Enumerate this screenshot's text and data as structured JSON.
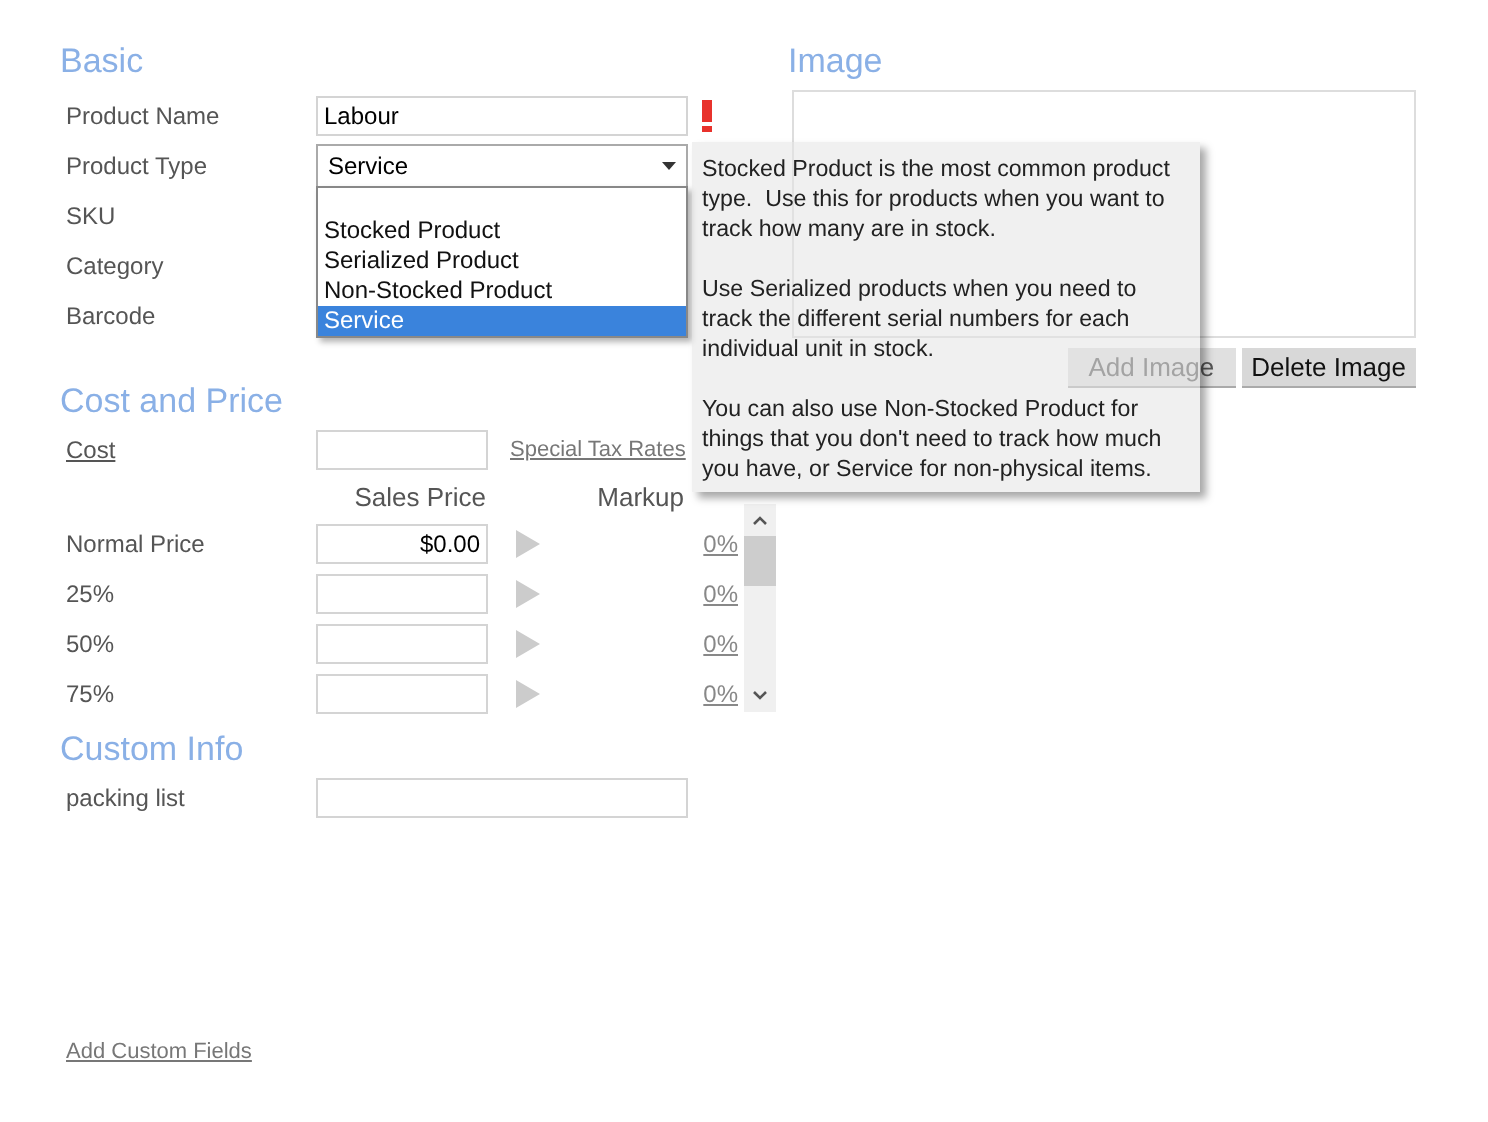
{
  "basic": {
    "title": "Basic",
    "fields": [
      {
        "label": "Product Name",
        "kind": "text",
        "value": "Labour",
        "required": true
      },
      {
        "label": "Product Type",
        "kind": "select",
        "value": "Service"
      },
      {
        "label": "SKU",
        "kind": "covered"
      },
      {
        "label": "Category",
        "kind": "covered"
      },
      {
        "label": "Barcode",
        "kind": "covered"
      }
    ],
    "dropdown": [
      {
        "label": "Stocked Product",
        "selected": false
      },
      {
        "label": "Serialized Product",
        "selected": false
      },
      {
        "label": "Non-Stocked Product",
        "selected": false
      },
      {
        "label": "Service",
        "selected": true
      }
    ]
  },
  "tooltip": [
    "Stocked Product is the most common product type.  Use this for products when you want to track how many are in stock.",
    "Use Serialized products when you need to track the different serial numbers for each individual unit in stock.",
    "You can also use Non-Stocked Product for things that you don't need to track how much you have, or Service for non-physical items."
  ],
  "image": {
    "title": "Image",
    "buttons": [
      {
        "label": "Add Image",
        "disabled": true
      },
      {
        "label": "Delete Image",
        "disabled": false
      }
    ]
  },
  "cost_and_price": {
    "title": "Cost and Price",
    "cost_label": "Cost",
    "tax_link": "Special Tax Rates",
    "columns": [
      "Sales Price",
      "Markup"
    ],
    "rows": [
      {
        "label": "Normal Price",
        "price": "$0.00",
        "markup": "0%"
      },
      {
        "label": "25%",
        "markup": "0%"
      },
      {
        "label": "50%",
        "markup": "0%"
      },
      {
        "label": "75%",
        "markup": "0%"
      }
    ]
  },
  "custom_info": {
    "title": "Custom Info",
    "fields": [
      {
        "label": "packing list"
      }
    ],
    "add_link": "Add Custom Fields"
  }
}
